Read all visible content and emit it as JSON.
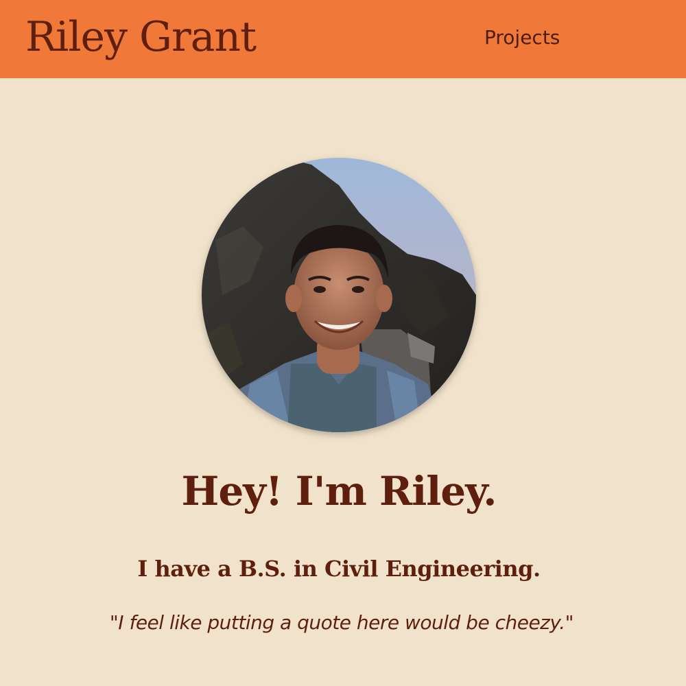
{
  "header": {
    "site_title": "Riley Grant",
    "nav": [
      {
        "label": "Projects"
      }
    ]
  },
  "hero": {
    "avatar_icon": "portrait-photo",
    "headline": "Hey! I'm Riley.",
    "subheadline": "I have a B.S. in Civil Engineering.",
    "quote": "\"I feel like putting a quote here would be cheezy.\""
  },
  "colors": {
    "header_bg": "#f07838",
    "page_bg": "#f1e3cb",
    "text": "#5e1f0f"
  }
}
